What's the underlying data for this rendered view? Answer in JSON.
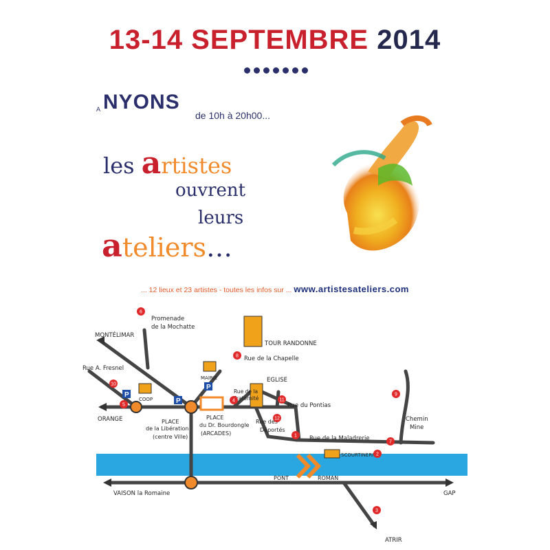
{
  "header": {
    "date_red": "13-14 SEPTEMBRE",
    "date_year": "2014",
    "a_label": "A",
    "city": "NYONS",
    "hours": "de 10h à 20h00..."
  },
  "headline": {
    "line1_big": "a",
    "line1_rest": "rtistes",
    "line1_prefix": "les ",
    "line2": "ouvrent",
    "line3": "leurs",
    "line4_big": "a",
    "line4_rest": "teliers",
    "line4_dots": "…"
  },
  "info": {
    "text": "... 12 lieux et 23 artistes - toutes les infos sur ...",
    "url": "www.artistesateliers.com"
  },
  "map": {
    "labels": {
      "montelimar": "MONTÉLIMAR",
      "orange": "ORANGE",
      "vaison": "VAISON la Romaine",
      "gap": "GAP",
      "atrir": "ATRIR",
      "promenade1": "Promenade",
      "promenade2": "de la Mochatte",
      "rue_fresnel": "Rue A. Fresnel",
      "coop": "COOP",
      "mairie": "MAIRIE",
      "tour": "TOUR RANDONNE",
      "chapelle": "Rue de la Chapelle",
      "eglise": "EGLISE",
      "fraternite1": "Rue de la",
      "fraternite2": "Fraternité",
      "pontias": "Rue du Pontias",
      "deportes1": "Rue des",
      "deportes2": "Déportés",
      "maladrerie": "Rue de la Maladrerie",
      "chemin1": "Chemin",
      "chemin2": "Mine",
      "scourtinerie": "SCOURTINERIE",
      "place_lib1": "PLACE",
      "place_lib2": "de la Libération",
      "place_lib3": "(centre Ville)",
      "place_dr1": "PLACE",
      "place_dr2": "du Dr. Bourdongle",
      "place_dr3": "(ARCADES)",
      "pont1": "PONT",
      "pont2": "ROMAN",
      "parking": "P"
    },
    "markers": [
      "1",
      "2",
      "3",
      "4",
      "5",
      "6",
      "7",
      "8",
      "9",
      "10",
      "11",
      "12"
    ]
  },
  "colors": {
    "red": "#c8202c",
    "navy": "#2a2f6b",
    "orange": "#f08a2a",
    "river": "#2aa7e0",
    "marker": "#e02a2a",
    "parking": "#1d4fa8"
  }
}
